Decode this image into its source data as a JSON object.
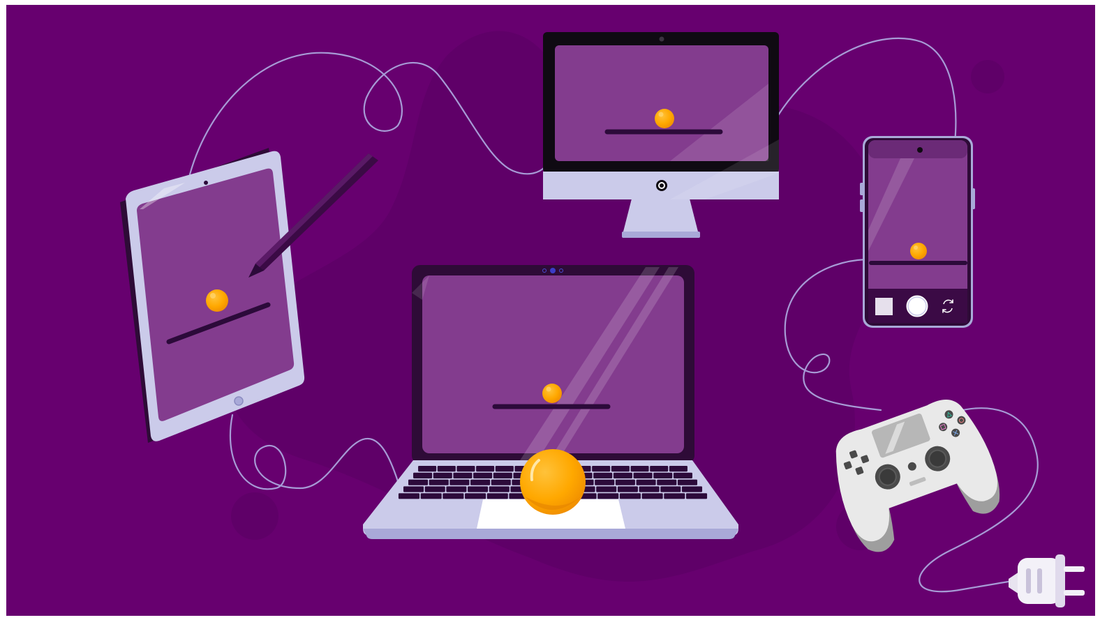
{
  "scene": {
    "devices": [
      "tablet",
      "stylus",
      "desktop-monitor",
      "smartphone",
      "laptop",
      "game-controller",
      "power-plug"
    ],
    "icons": [
      "pong-ball",
      "pong-paddle",
      "camera-shutter-button",
      "camera-switch-icon",
      "gallery-thumbnail"
    ]
  },
  "colors": {
    "background": "#67006F",
    "background_blob": "#5F0068",
    "screen": "#833C8E",
    "screen_dark": "#2E0B37",
    "paddle": "#2C0A3A",
    "ball": "#FFA800",
    "ball_highlight": "#FFD36B",
    "device_silver": "#CBCBEA",
    "device_silver_dark": "#A9A9D8",
    "cable": "#A79BD6",
    "controller_white": "#E9E9E9",
    "controller_grey": "#9E9E9E"
  }
}
